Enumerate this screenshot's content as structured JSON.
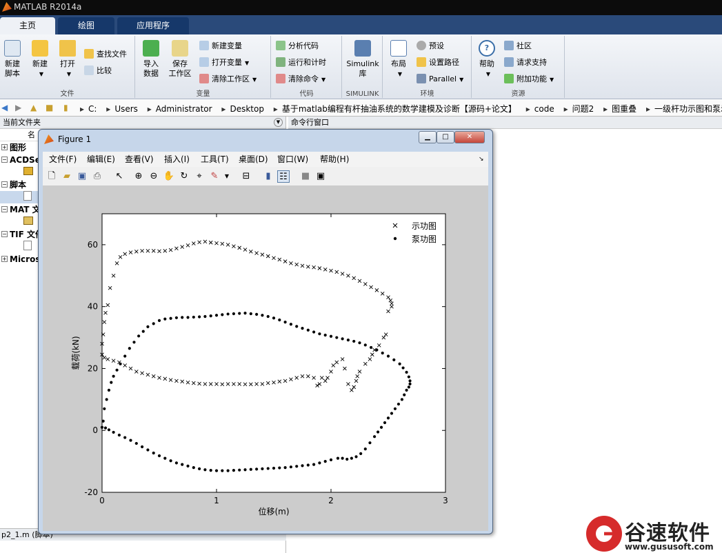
{
  "app": {
    "title": "MATLAB R2014a"
  },
  "tabs": [
    {
      "label": "主页"
    },
    {
      "label": "绘图"
    },
    {
      "label": "应用程序"
    }
  ],
  "ribbon": {
    "file": {
      "label": "文件",
      "new_script": "新建\n脚本",
      "new": "新建",
      "open": "打开",
      "find_files": "查找文件",
      "compare": "比较"
    },
    "variable": {
      "label": "变量",
      "import": "导入\n数据",
      "save_ws": "保存\n工作区",
      "new_var": "新建变量",
      "open_var": "打开变量",
      "clear_ws": "清除工作区"
    },
    "code": {
      "label": "代码",
      "analyze": "分析代码",
      "run_time": "运行和计时",
      "clear_cmds": "清除命令"
    },
    "simulink": {
      "label": "SIMULINK",
      "btn": "Simulink\n库"
    },
    "env": {
      "label": "环境",
      "layout": "布局",
      "prefs": "预设",
      "set_path": "设置路径",
      "parallel": "Parallel"
    },
    "resources": {
      "label": "资源",
      "help": "帮助",
      "community": "社区",
      "support": "请求支持",
      "addons": "附加功能"
    }
  },
  "address": {
    "crumbs": [
      "C:",
      "Users",
      "Administrator",
      "Desktop",
      "基于matlab编程有杆抽油系统的数学建模及诊断【源码+论文】",
      "code",
      "问题2",
      "图重叠",
      "一级杆功示图和泵示图"
    ]
  },
  "current_folder": {
    "header": "当前文件夹",
    "col_name": "名",
    "tree": [
      {
        "label": "图形"
      },
      {
        "label": "ACDSe"
      },
      {
        "label": "脚本"
      },
      {
        "label": "MAT 文"
      },
      {
        "label": "TIF 文件"
      },
      {
        "label": "Micros"
      }
    ],
    "status": "p2_1.m (脚本)"
  },
  "command_window": {
    "header": "命令行窗口"
  },
  "figure": {
    "title": "Figure 1",
    "menu": [
      "文件(F)",
      "编辑(E)",
      "查看(V)",
      "插入(I)",
      "工具(T)",
      "桌面(D)",
      "窗口(W)",
      "帮助(H)"
    ]
  },
  "chart_data": {
    "type": "scatter",
    "xlabel": "位移(m)",
    "ylabel": "载荷(kN)",
    "xlim": [
      0,
      3
    ],
    "ylim": [
      -20,
      70
    ],
    "xticks": [
      0,
      1,
      2,
      3
    ],
    "yticks": [
      -20,
      0,
      20,
      40,
      60
    ],
    "legend_position": "top-right",
    "series": [
      {
        "name": "示功图",
        "marker": "x",
        "points": [
          [
            0,
            24.5
          ],
          [
            0,
            28
          ],
          [
            0.01,
            31
          ],
          [
            0.02,
            35
          ],
          [
            0.03,
            38
          ],
          [
            0.05,
            40.5
          ],
          [
            0.07,
            46
          ],
          [
            0.1,
            50
          ],
          [
            0.13,
            54
          ],
          [
            0.16,
            56
          ],
          [
            0.2,
            57
          ],
          [
            0.25,
            57.5
          ],
          [
            0.3,
            57.8
          ],
          [
            0.35,
            58
          ],
          [
            0.4,
            58
          ],
          [
            0.45,
            58
          ],
          [
            0.5,
            57.9
          ],
          [
            0.55,
            58
          ],
          [
            0.6,
            58.3
          ],
          [
            0.65,
            58.8
          ],
          [
            0.7,
            59.3
          ],
          [
            0.75,
            59.8
          ],
          [
            0.8,
            60.4
          ],
          [
            0.85,
            60.8
          ],
          [
            0.9,
            61
          ],
          [
            0.95,
            60.7
          ],
          [
            1.0,
            60.5
          ],
          [
            1.05,
            60.3
          ],
          [
            1.1,
            60
          ],
          [
            1.15,
            59.5
          ],
          [
            1.2,
            59
          ],
          [
            1.25,
            58.4
          ],
          [
            1.3,
            57.8
          ],
          [
            1.35,
            57.3
          ],
          [
            1.4,
            56.8
          ],
          [
            1.45,
            56.3
          ],
          [
            1.5,
            55.7
          ],
          [
            1.55,
            55.2
          ],
          [
            1.6,
            54.6
          ],
          [
            1.65,
            54
          ],
          [
            1.7,
            53.6
          ],
          [
            1.75,
            53.2
          ],
          [
            1.8,
            52.9
          ],
          [
            1.85,
            52.7
          ],
          [
            1.9,
            52.4
          ],
          [
            1.95,
            52
          ],
          [
            2.0,
            51.6
          ],
          [
            2.05,
            51.2
          ],
          [
            2.1,
            50.6
          ],
          [
            2.15,
            50
          ],
          [
            2.2,
            49.2
          ],
          [
            2.25,
            48.3
          ],
          [
            2.3,
            47.3
          ],
          [
            2.35,
            46.3
          ],
          [
            2.4,
            45.3
          ],
          [
            2.45,
            44.2
          ],
          [
            2.5,
            43
          ],
          [
            2.52,
            42
          ],
          [
            2.53,
            41
          ],
          [
            2.53,
            40
          ],
          [
            2.5,
            38.5
          ],
          [
            2.48,
            31
          ],
          [
            2.46,
            30
          ],
          [
            2.42,
            27.5
          ],
          [
            2.38,
            26
          ],
          [
            2.36,
            24.5
          ],
          [
            2.34,
            23
          ],
          [
            2.3,
            21.5
          ],
          [
            2.25,
            19
          ],
          [
            2.23,
            17.5
          ],
          [
            2.22,
            16
          ],
          [
            2.2,
            14
          ],
          [
            2.18,
            13
          ],
          [
            2.15,
            15
          ],
          [
            2.12,
            20
          ],
          [
            2.1,
            23
          ],
          [
            2.05,
            22
          ],
          [
            2.02,
            21
          ],
          [
            2.0,
            19
          ],
          [
            1.97,
            17
          ],
          [
            1.95,
            16
          ],
          [
            1.92,
            17
          ],
          [
            1.9,
            15
          ],
          [
            1.88,
            14.5
          ],
          [
            1.85,
            17
          ],
          [
            1.8,
            17.5
          ],
          [
            1.75,
            17.5
          ],
          [
            1.7,
            17
          ],
          [
            1.65,
            16.5
          ],
          [
            1.6,
            16
          ],
          [
            1.55,
            15.8
          ],
          [
            1.5,
            15.5
          ],
          [
            1.45,
            15.3
          ],
          [
            1.4,
            15
          ],
          [
            1.35,
            15
          ],
          [
            1.3,
            14.9
          ],
          [
            1.25,
            14.9
          ],
          [
            1.2,
            15
          ],
          [
            1.15,
            15
          ],
          [
            1.1,
            15
          ],
          [
            1.05,
            14.9
          ],
          [
            1.0,
            15
          ],
          [
            0.95,
            15
          ],
          [
            0.9,
            15
          ],
          [
            0.85,
            15.1
          ],
          [
            0.8,
            15.3
          ],
          [
            0.75,
            15.5
          ],
          [
            0.7,
            15.8
          ],
          [
            0.65,
            16
          ],
          [
            0.6,
            16.3
          ],
          [
            0.55,
            16.7
          ],
          [
            0.5,
            17
          ],
          [
            0.45,
            17.5
          ],
          [
            0.4,
            18
          ],
          [
            0.35,
            18.5
          ],
          [
            0.3,
            19
          ],
          [
            0.25,
            20
          ],
          [
            0.2,
            21
          ],
          [
            0.15,
            22
          ],
          [
            0.1,
            22.5
          ],
          [
            0.05,
            23
          ],
          [
            0.02,
            23.5
          ]
        ]
      },
      {
        "name": "泵功图",
        "marker": "dot",
        "points": [
          [
            0,
            1
          ],
          [
            0.01,
            3
          ],
          [
            0.02,
            7
          ],
          [
            0.04,
            10
          ],
          [
            0.06,
            13
          ],
          [
            0.08,
            15.5
          ],
          [
            0.1,
            17.5
          ],
          [
            0.13,
            19.5
          ],
          [
            0.16,
            21.5
          ],
          [
            0.2,
            24
          ],
          [
            0.24,
            26.5
          ],
          [
            0.28,
            28.5
          ],
          [
            0.32,
            30.5
          ],
          [
            0.36,
            32
          ],
          [
            0.4,
            33.5
          ],
          [
            0.45,
            34.5
          ],
          [
            0.5,
            35.5
          ],
          [
            0.55,
            36
          ],
          [
            0.6,
            36.2
          ],
          [
            0.65,
            36.4
          ],
          [
            0.7,
            36.5
          ],
          [
            0.75,
            36.5
          ],
          [
            0.8,
            36.6
          ],
          [
            0.85,
            36.7
          ],
          [
            0.9,
            36.8
          ],
          [
            0.95,
            37
          ],
          [
            1.0,
            37.2
          ],
          [
            1.05,
            37.4
          ],
          [
            1.1,
            37.6
          ],
          [
            1.15,
            37.7
          ],
          [
            1.2,
            37.8
          ],
          [
            1.25,
            37.9
          ],
          [
            1.3,
            37.7
          ],
          [
            1.35,
            37.5
          ],
          [
            1.4,
            37.2
          ],
          [
            1.45,
            36.8
          ],
          [
            1.5,
            36.3
          ],
          [
            1.55,
            35.7
          ],
          [
            1.6,
            35
          ],
          [
            1.65,
            34.3
          ],
          [
            1.7,
            33.6
          ],
          [
            1.75,
            33
          ],
          [
            1.8,
            32.4
          ],
          [
            1.85,
            31.8
          ],
          [
            1.9,
            31.2
          ],
          [
            1.95,
            30.8
          ],
          [
            2.0,
            30.4
          ],
          [
            2.05,
            30
          ],
          [
            2.1,
            29.6
          ],
          [
            2.15,
            29.2
          ],
          [
            2.2,
            28.8
          ],
          [
            2.25,
            28.3
          ],
          [
            2.3,
            27.6
          ],
          [
            2.35,
            26.8
          ],
          [
            2.4,
            26
          ],
          [
            2.45,
            25
          ],
          [
            2.5,
            24
          ],
          [
            2.55,
            22.8
          ],
          [
            2.6,
            21.5
          ],
          [
            2.63,
            20.2
          ],
          [
            2.66,
            18.8
          ],
          [
            2.68,
            17.3
          ],
          [
            2.69,
            16
          ],
          [
            2.69,
            15
          ],
          [
            2.68,
            14
          ],
          [
            2.66,
            13
          ],
          [
            2.64,
            11.5
          ],
          [
            2.62,
            10
          ],
          [
            2.59,
            8.5
          ],
          [
            2.56,
            7
          ],
          [
            2.53,
            5.5
          ],
          [
            2.5,
            4
          ],
          [
            2.47,
            2.5
          ],
          [
            2.44,
            1
          ],
          [
            2.41,
            -0.5
          ],
          [
            2.38,
            -2
          ],
          [
            2.34,
            -4
          ],
          [
            2.3,
            -6
          ],
          [
            2.26,
            -7.5
          ],
          [
            2.22,
            -8.5
          ],
          [
            2.18,
            -9
          ],
          [
            2.14,
            -9.3
          ],
          [
            2.1,
            -9
          ],
          [
            2.06,
            -9
          ],
          [
            2.0,
            -9.5
          ],
          [
            1.95,
            -10
          ],
          [
            1.9,
            -10.5
          ],
          [
            1.85,
            -11
          ],
          [
            1.8,
            -11.2
          ],
          [
            1.75,
            -11.4
          ],
          [
            1.7,
            -11.6
          ],
          [
            1.65,
            -11.8
          ],
          [
            1.6,
            -12
          ],
          [
            1.55,
            -12.1
          ],
          [
            1.5,
            -12.2
          ],
          [
            1.45,
            -12.3
          ],
          [
            1.4,
            -12.4
          ],
          [
            1.35,
            -12.5
          ],
          [
            1.3,
            -12.6
          ],
          [
            1.25,
            -12.7
          ],
          [
            1.2,
            -12.8
          ],
          [
            1.15,
            -12.9
          ],
          [
            1.1,
            -13
          ],
          [
            1.05,
            -13
          ],
          [
            1.0,
            -13
          ],
          [
            0.95,
            -12.9
          ],
          [
            0.9,
            -12.7
          ],
          [
            0.85,
            -12.4
          ],
          [
            0.8,
            -12
          ],
          [
            0.75,
            -11.5
          ],
          [
            0.7,
            -11
          ],
          [
            0.65,
            -10.5
          ],
          [
            0.6,
            -9.8
          ],
          [
            0.55,
            -9
          ],
          [
            0.5,
            -8.2
          ],
          [
            0.45,
            -7.3
          ],
          [
            0.4,
            -6.3
          ],
          [
            0.35,
            -5.3
          ],
          [
            0.3,
            -4.2
          ],
          [
            0.25,
            -3.2
          ],
          [
            0.2,
            -2.3
          ],
          [
            0.15,
            -1.5
          ],
          [
            0.1,
            -0.6
          ],
          [
            0.06,
            0.2
          ],
          [
            0.03,
            0.8
          ]
        ]
      }
    ]
  },
  "watermark": {
    "name": "谷速软件",
    "url": "www.gususoft.com"
  },
  "colors": {
    "titlebar": "#0c0c0c",
    "tab_bg": "#2a4a7a",
    "plot_bg": "#cccccc",
    "brand_red": "#d62b2b"
  }
}
